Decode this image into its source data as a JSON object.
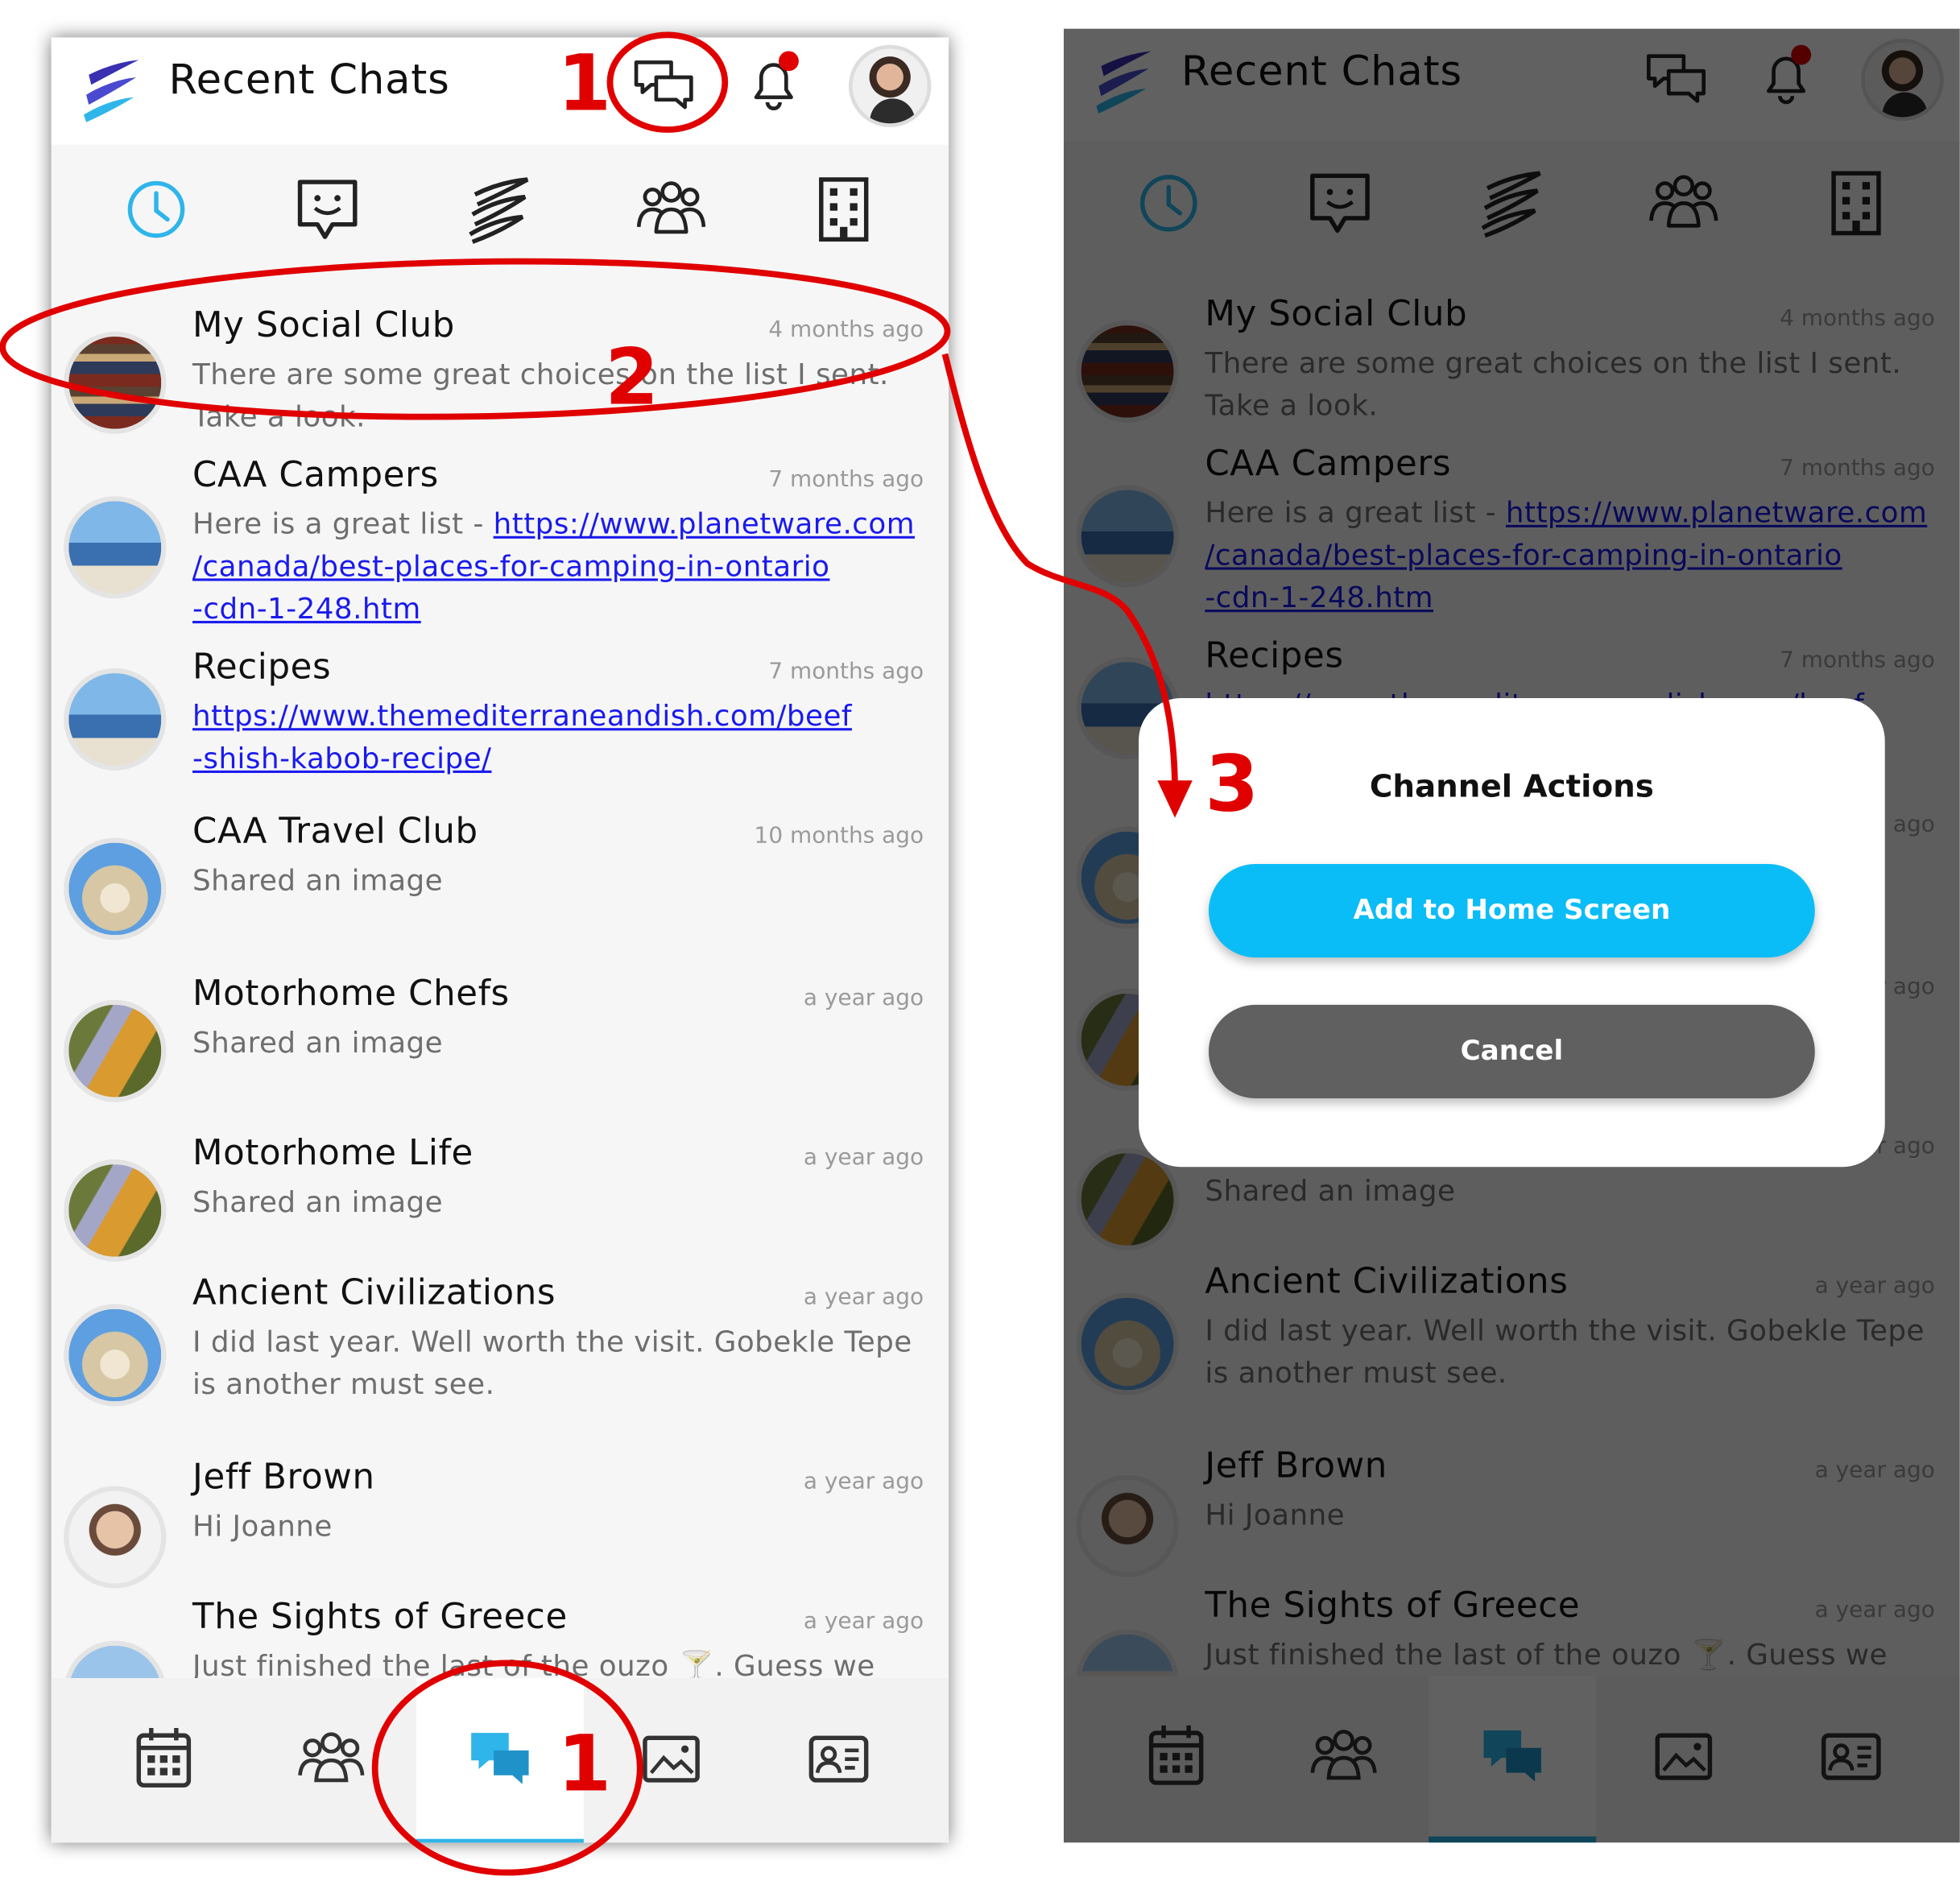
{
  "app": {
    "title": "Recent Chats"
  },
  "header_icons": {
    "messages": "chat-bubbles-icon",
    "notifications": "bell-icon",
    "profile": "avatar"
  },
  "category_tabs": [
    {
      "name": "recent",
      "icon": "clock-icon"
    },
    {
      "name": "direct",
      "icon": "smiley-chat-icon"
    },
    {
      "name": "brand",
      "icon": "logo-icon"
    },
    {
      "name": "groups",
      "icon": "people-icon"
    },
    {
      "name": "organization",
      "icon": "building-icon"
    }
  ],
  "chats": [
    {
      "name": "My Social Club",
      "time": "4 months ago",
      "message": "There are some great choices on the list I sent.\nTake a look.",
      "avatar": "books"
    },
    {
      "name": "CAA Campers",
      "time": "7 months ago",
      "message_prefix": "Here is a great list - ",
      "link": "https://www.planetware.com\n/canada/best-places-for-camping-in-ontario\n-cdn-1-248.htm",
      "avatar": "van"
    },
    {
      "name": "Recipes",
      "time": "7 months ago",
      "link": "https://www.themediterraneandish.com/beef\n-shish-kabob-recipe/",
      "avatar": "van"
    },
    {
      "name": "CAA Travel Club",
      "time": "10 months ago",
      "message": "Shared an image",
      "avatar": "arch"
    },
    {
      "name": "Motorhome Chefs",
      "time": "a year ago",
      "message": "Shared an image",
      "avatar": "road"
    },
    {
      "name": "Motorhome Life",
      "time": "a year ago",
      "message": "Shared an image",
      "avatar": "road"
    },
    {
      "name": "Ancient Civilizations",
      "time": "a year ago",
      "message": "I did last year. Well worth the visit. Gobekle Tepe\nis another must see.",
      "avatar": "arch"
    },
    {
      "name": "Jeff Brown",
      "time": "a year ago",
      "message": "Hi Joanne",
      "avatar": "person"
    },
    {
      "name": "The Sights of Greece",
      "time": "a year ago",
      "message": "Just finished the last of the ouzo 🍸. Guess we",
      "avatar": "coast"
    }
  ],
  "bottom_nav": [
    {
      "name": "calendar",
      "icon": "calendar-icon"
    },
    {
      "name": "groups",
      "icon": "people-icon"
    },
    {
      "name": "chats",
      "icon": "chat-bubbles-icon",
      "active": true
    },
    {
      "name": "gallery",
      "icon": "gallery-icon"
    },
    {
      "name": "contacts",
      "icon": "contact-card-icon"
    }
  ],
  "dialog": {
    "title": "Channel Actions",
    "primary_label": "Add to Home Screen",
    "cancel_label": "Cancel"
  },
  "annotations": {
    "step_header": "1",
    "step_row": "2",
    "step_dialog": "3",
    "step_bottom": "1"
  },
  "colors": {
    "accent": "#2fb5ea",
    "primary_button": "#0bbdf7",
    "cancel_button": "#606060",
    "annotation": "#e00000",
    "link": "#1a1aee"
  }
}
